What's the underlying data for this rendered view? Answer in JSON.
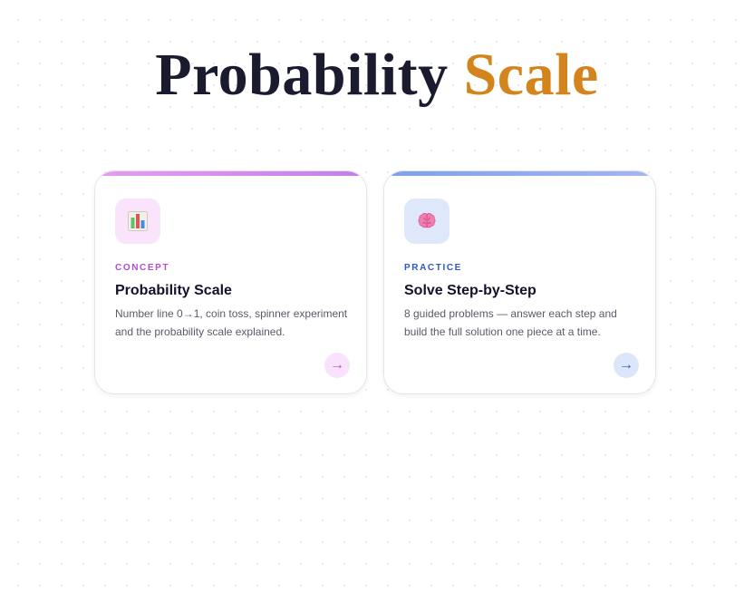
{
  "header": {
    "title_main": "Probability",
    "title_accent": "Scale"
  },
  "cards": [
    {
      "tag": "CONCEPT",
      "title": "Probability Scale",
      "description": "Number line 0→1, coin toss, spinner experiment and the probability scale explained.",
      "icon": "bar-chart-icon",
      "arrow": "→",
      "accent": "#b44bd0"
    },
    {
      "tag": "PRACTICE",
      "title": "Solve Step-by-Step",
      "description": "8 guided problems — answer each step and build the full solution one piece at a time.",
      "icon": "brain-icon",
      "arrow": "→",
      "accent": "#2f58c8"
    }
  ],
  "colors": {
    "title": "#1b1b30",
    "title_accent": "#d4841c"
  }
}
